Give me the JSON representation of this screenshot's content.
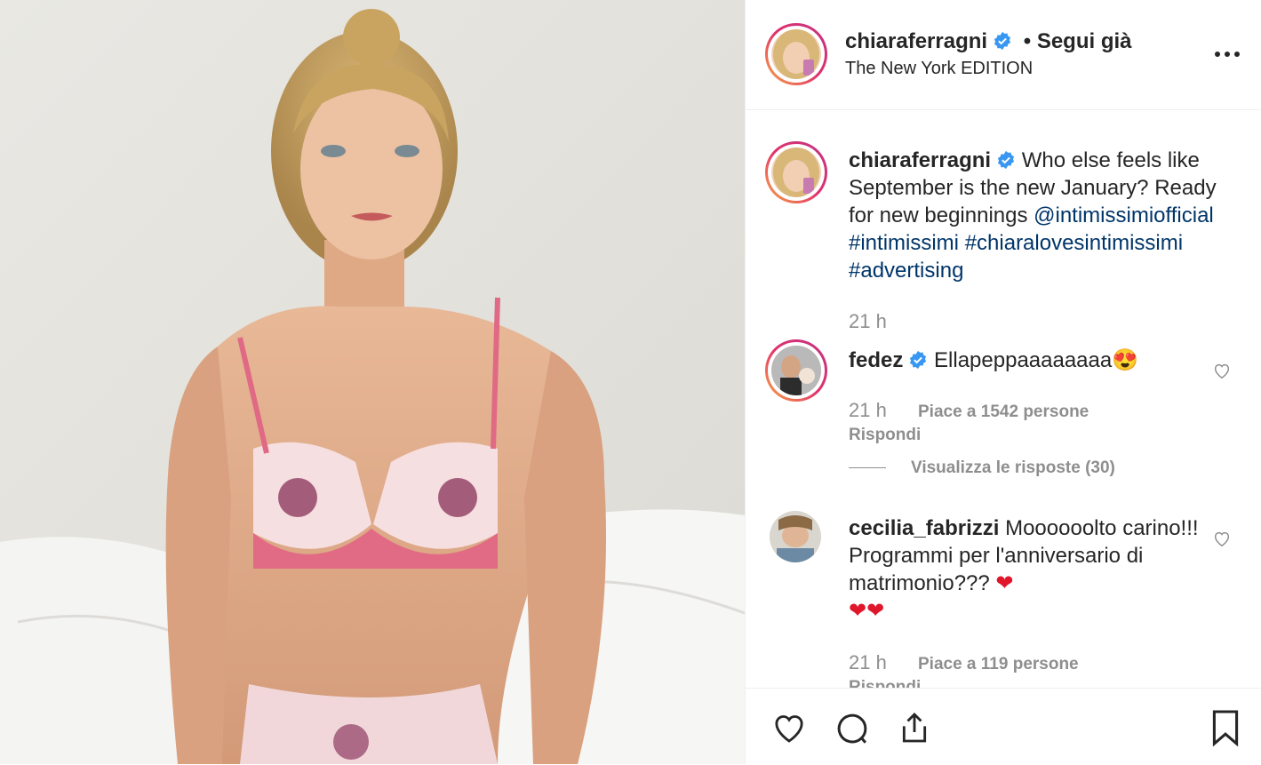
{
  "post": {
    "username": "chiaraferragni",
    "follow_status": "• Segui già",
    "location": "The New York EDITION",
    "more_icon": "more-dots-icon"
  },
  "caption": {
    "username": "chiaraferragni",
    "text": "Who else feels like September is the new January? Ready for new beginnings",
    "mention": "@intimissimiofficial",
    "hashtags": [
      "#intimissimi",
      "#chiaralovesintimissimi",
      "#advertising"
    ],
    "time": "21 h"
  },
  "comments": [
    {
      "username": "fedez",
      "verified": true,
      "text": "Ellapeppaaaaaaaa",
      "emoji": "😍",
      "time": "21 h",
      "likes": "Piace a 1542 persone",
      "reply": "Rispondi",
      "view_replies": "Visualizza le risposte (30)"
    },
    {
      "username": "cecilia_fabrizzi",
      "verified": false,
      "text": "Moooooolto carino!!! Programmi per l'anniversario di matrimonio???",
      "emoji": "❤",
      "emoji_line2": "❤❤",
      "time": "21 h",
      "likes": "Piace a 119 persone",
      "reply": "Rispondi"
    }
  ],
  "colors": {
    "link": "#003569",
    "verified": "#3897f0",
    "muted": "#8e8e8e",
    "story_ring": "#e1306c"
  },
  "icons": [
    "like-heart-icon",
    "comment-icon",
    "share-icon",
    "bookmark-icon",
    "verified-badge-icon"
  ]
}
